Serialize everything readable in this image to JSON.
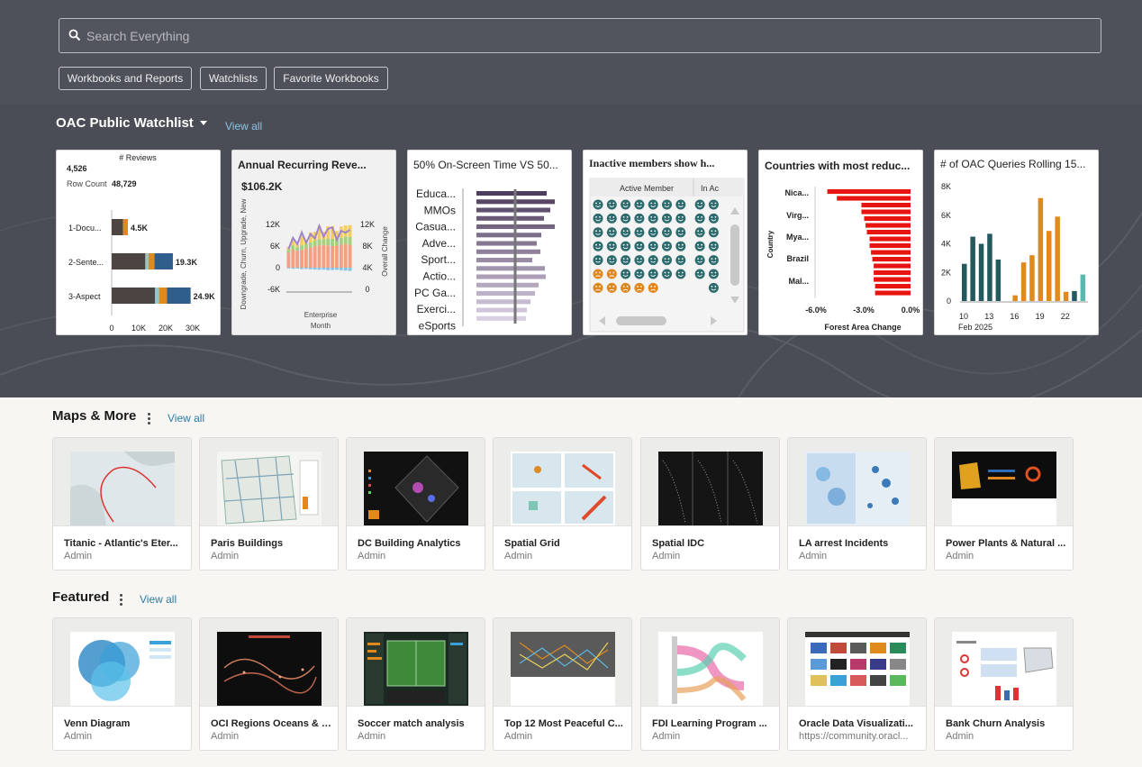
{
  "search": {
    "placeholder": "Search Everything"
  },
  "filters": [
    "Workbooks and Reports",
    "Watchlists",
    "Favorite Workbooks"
  ],
  "watchlist": {
    "title": "OAC Public Watchlist",
    "view_all": "View all",
    "cards": [
      {
        "kpi_label": "# Reviews",
        "kpi_value": "4,526",
        "row_count_label": "Row Count",
        "row_count_value": "48,729",
        "chart_data": {
          "type": "bar",
          "orientation": "horizontal",
          "stacked": true,
          "categories": [
            "1-Docu...",
            "2-Sente...",
            "3-Aspect"
          ],
          "totals": [
            4500,
            19300,
            24900
          ],
          "data_labels": [
            "4.5K",
            "19.3K",
            "24.9K"
          ],
          "xticks": [
            "0",
            "10K",
            "20K",
            "30K"
          ],
          "xlim": [
            0,
            30000
          ],
          "colors": [
            "#4b4440",
            "#e08a1e",
            "#8fc7cf",
            "#2f5d8c"
          ]
        }
      },
      {
        "title": "Annual Recurring Reve...",
        "kpi_value": "$106.2K",
        "chart_data": {
          "type": "bar",
          "stacked": true,
          "left_ylabel": "Downgrade, Churn, Upgrade, New",
          "right_ylabel": "Overall Change",
          "left_yticks": [
            "12K",
            "6K",
            "0",
            "-6K"
          ],
          "right_yticks": [
            "12K",
            "8K",
            "4K",
            "0"
          ],
          "xlabel": "Enterprise",
          "xlabel2": "Month",
          "ylim": [
            -6000,
            12000
          ],
          "series": [
            {
              "name": "",
              "color": "#f3a082",
              "values": [
                4200,
                5000,
                4700,
                4900,
                5400,
                5600,
                6000,
                6200,
                6300,
                6200,
                6000,
                6100,
                6400,
                6600,
                6300
              ]
            },
            {
              "name": "",
              "color": "#a5d07f",
              "values": [
                900,
                1200,
                1000,
                1300,
                1100,
                1400,
                1500,
                1700,
                1600,
                1900,
                2000,
                1800,
                1900,
                2100,
                2200
              ]
            },
            {
              "name": "",
              "color": "#f6cd61",
              "values": [
                700,
                1800,
                800,
                2600,
                1300,
                2800,
                2400,
                3700,
                2100,
                3400,
                3500,
                2300,
                3100,
                3000,
                3300
              ]
            },
            {
              "name": "",
              "color": "#87c2e8",
              "values": [
                -200,
                -300,
                -250,
                -400,
                -350,
                -450,
                -500,
                -600,
                -550,
                -700,
                -650,
                -600,
                -700,
                -800,
                -900
              ]
            }
          ],
          "line": {
            "color": "#9e86c8",
            "values": [
              5200,
              8300,
              6500,
              9800,
              6900,
              9300,
              8100,
              11600,
              8600,
              10800,
              11200,
              7700,
              10200,
              9700,
              10500
            ]
          }
        }
      },
      {
        "title": "50% On-Screen Time VS 50...",
        "chart_data": {
          "type": "bar",
          "orientation": "horizontal",
          "categories": [
            "Educa...",
            "MMOs",
            "Casua...",
            "Adve...",
            "Sport...",
            "Actio...",
            "PC Ga...",
            "Exerci...",
            "eSports"
          ],
          "values": [
            78,
            87,
            82,
            75,
            87,
            72,
            67,
            71,
            62,
            76,
            77,
            69,
            65,
            60,
            56,
            55
          ],
          "reference_line": true,
          "colors": [
            "#4e3d5c",
            "#d9cfe3"
          ]
        }
      },
      {
        "title": "Inactive members show h...",
        "column_header": "Active Member",
        "column_header2": "In Ac",
        "chart_data": {
          "type": "table",
          "icon_grid": {
            "rows": [
              [
                7,
                7
              ],
              [
                7,
                7
              ],
              [
                7,
                7
              ],
              [
                7,
                7
              ],
              [
                7,
                7
              ],
              [
                7,
                7
              ],
              [
                7,
                7
              ]
            ],
            "happy_color": "#2d6b6e",
            "sad_color": "#e0871e",
            "sad_counts": [
              0,
              0,
              0,
              0,
              0,
              2,
              5
            ],
            "sad_right": [
              0,
              0,
              0,
              0,
              0,
              1,
              1
            ]
          }
        }
      },
      {
        "title": "Countries with most reduc...",
        "chart_data": {
          "type": "bar",
          "orientation": "horizontal",
          "ylabel": "Country",
          "xlabel": "Forest Area Change",
          "categories": [
            "Nica...",
            "Virg...",
            "Mya...",
            "Brazil",
            "Mal..."
          ],
          "xticks": [
            "-6.0%",
            "-3.0%",
            "0.0%"
          ],
          "xlim": [
            -7,
            0
          ],
          "values": [
            -6.1,
            -5.4,
            -3.6,
            -3.6,
            -3.4,
            -3.3,
            -3.2,
            -3.0,
            -3.0,
            -2.9,
            -2.8,
            -2.7,
            -2.7,
            -2.7,
            -2.6,
            -2.6
          ],
          "color": "#e8140f"
        }
      },
      {
        "title": "# of OAC Queries Rolling 15...",
        "chart_data": {
          "type": "bar",
          "x": [
            10,
            11,
            12,
            13,
            14,
            15,
            16,
            17,
            18,
            19,
            20,
            21,
            22,
            23,
            24
          ],
          "xticks": [
            "10",
            "13",
            "16",
            "19",
            "22"
          ],
          "xlabel2": "Feb 2025",
          "yticks": [
            "8K",
            "6K",
            "4K",
            "2K",
            "0"
          ],
          "ylim": [
            0,
            8000
          ],
          "values": [
            2600,
            4500,
            4000,
            4700,
            2900,
            0,
            400,
            2700,
            3200,
            7200,
            4900,
            5900,
            650,
            700,
            1850
          ],
          "colors": [
            "#24595e",
            "#24595e",
            "#24595e",
            "#24595e",
            "#24595e",
            "#e08a1e",
            "#e08a1e",
            "#e08a1e",
            "#e08a1e",
            "#e08a1e",
            "#e08a1e",
            "#e08a1e",
            "#e08a1e",
            "#24595e",
            "#5cb8ae"
          ]
        }
      }
    ]
  },
  "maps": {
    "title": "Maps & More",
    "view_all": "View all",
    "items": [
      {
        "name": "Titanic - Atlantic's Eter...",
        "owner": "Admin"
      },
      {
        "name": "Paris Buildings",
        "owner": "Admin"
      },
      {
        "name": "DC Building Analytics",
        "owner": "Admin"
      },
      {
        "name": "Spatial Grid",
        "owner": "Admin"
      },
      {
        "name": "Spatial IDC",
        "owner": "Admin"
      },
      {
        "name": "LA arrest Incidents",
        "owner": "Admin"
      },
      {
        "name": "Power Plants & Natural ...",
        "owner": "Admin"
      }
    ]
  },
  "featured": {
    "title": "Featured",
    "view_all": "View all",
    "items": [
      {
        "name": "Venn Diagram",
        "owner": "Admin"
      },
      {
        "name": "OCI Regions Oceans & C...",
        "owner": "Admin"
      },
      {
        "name": "Soccer match analysis",
        "owner": "Admin"
      },
      {
        "name": "Top 12 Most Peaceful C...",
        "owner": "Admin"
      },
      {
        "name": "FDI Learning Program ...",
        "owner": "Admin"
      },
      {
        "name": "Oracle Data Visualizati...",
        "owner": "https://community.oracl..."
      },
      {
        "name": "Bank Churn Analysis",
        "owner": "Admin"
      }
    ]
  }
}
